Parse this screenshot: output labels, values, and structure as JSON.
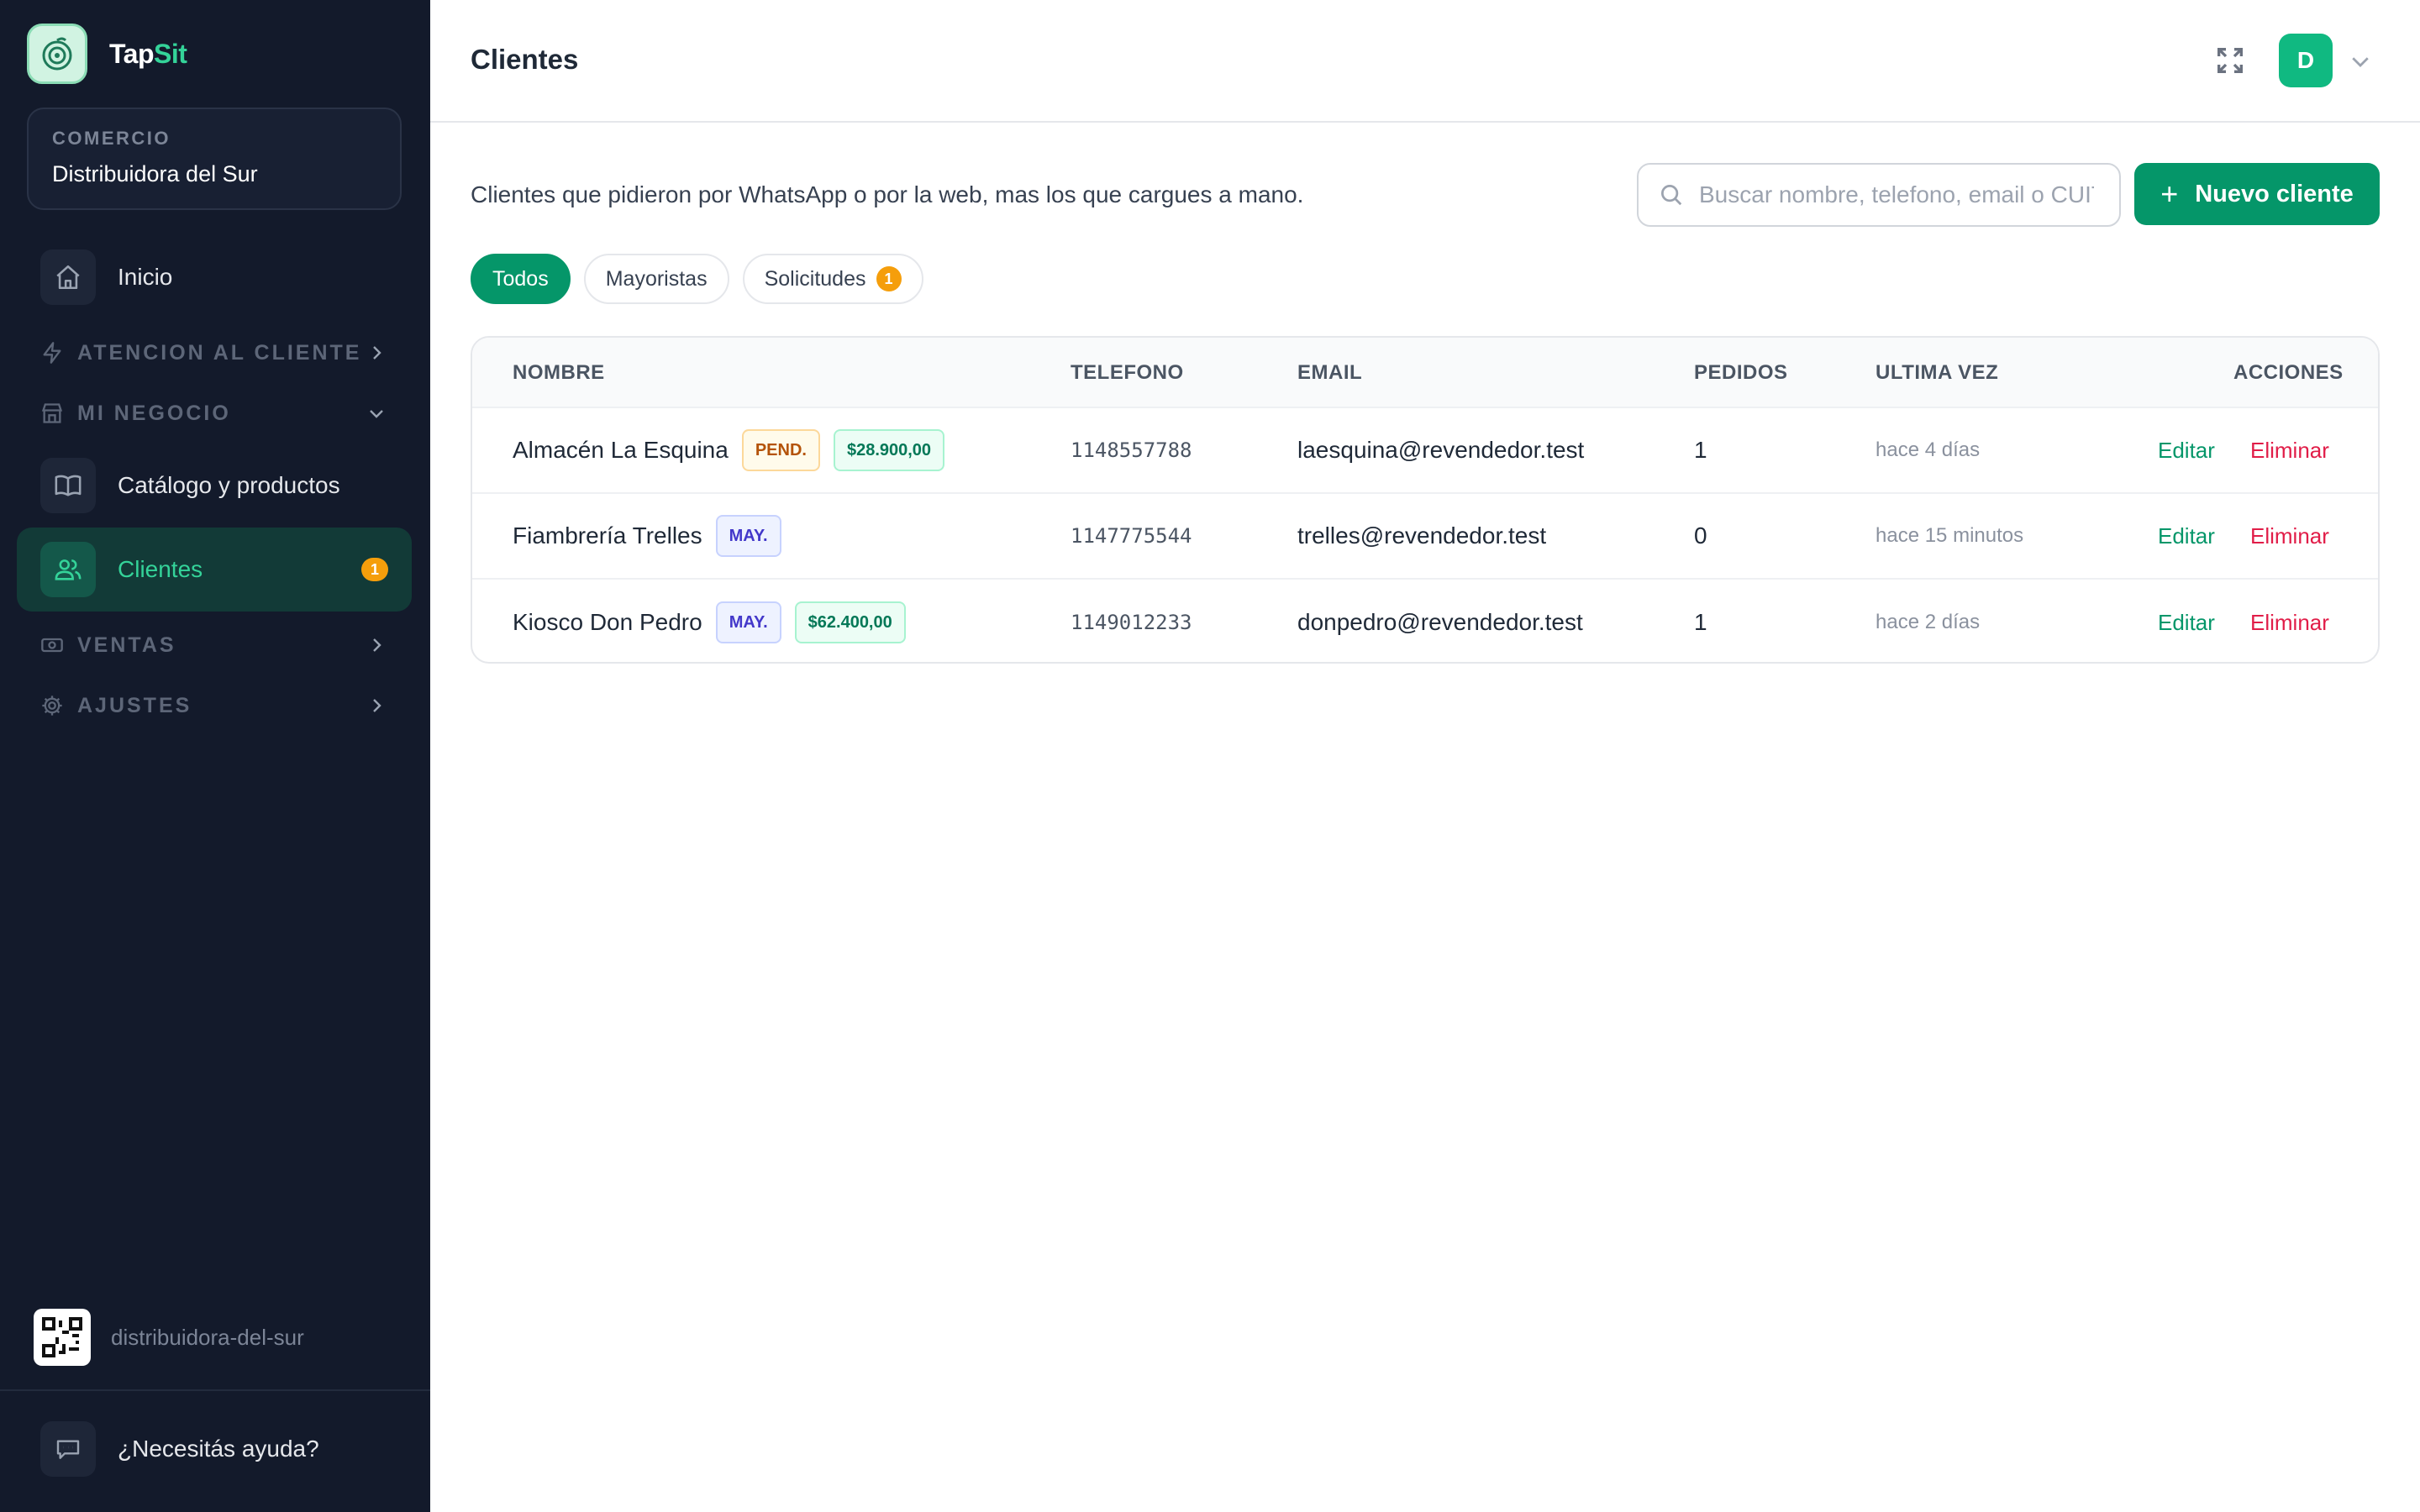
{
  "brand": {
    "name_part1": "Tap",
    "name_part2": "Sit",
    "accent_color": "#34d399"
  },
  "store": {
    "label": "COMERCIO",
    "name": "Distribuidora del Sur"
  },
  "sidebar": {
    "home": {
      "label": "Inicio",
      "icon": "home-icon"
    },
    "sections": [
      {
        "label": "ATENCION AL CLIENTE",
        "icon": "bolt-icon",
        "expanded": false
      },
      {
        "label": "MI NEGOCIO",
        "icon": "store-icon",
        "expanded": true
      },
      {
        "label": "VENTAS",
        "icon": "cash-icon",
        "expanded": false
      },
      {
        "label": "AJUSTES",
        "icon": "gear-icon",
        "expanded": false
      }
    ],
    "catalog": {
      "label": "Catálogo y productos",
      "icon": "book-icon"
    },
    "clients": {
      "label": "Clientes",
      "icon": "users-icon",
      "badge": "1",
      "active": true
    },
    "slug": "distribuidora-del-sur",
    "help": {
      "label": "¿Necesitás ayuda?",
      "icon": "chat-icon"
    }
  },
  "header": {
    "title": "Clientes",
    "avatar_initial": "D"
  },
  "content": {
    "subtitle": "Clientes que pidieron por WhatsApp o por la web, mas los que cargues a mano.",
    "search_placeholder": "Buscar nombre, telefono, email o CUIT",
    "new_button": "Nuevo cliente"
  },
  "filters": [
    {
      "label": "Todos",
      "active": true
    },
    {
      "label": "Mayoristas",
      "active": false
    },
    {
      "label": "Solicitudes",
      "active": false,
      "badge": "1"
    }
  ],
  "table": {
    "columns": [
      "NOMBRE",
      "TELEFONO",
      "EMAIL",
      "PEDIDOS",
      "ULTIMA VEZ",
      "ACCIONES"
    ],
    "rows": [
      {
        "name": "Almacén La Esquina",
        "tag": "PEND.",
        "amount": "$28.900,00",
        "phone": "1148557788",
        "email": "laesquina@revendedor.test",
        "orders": "1",
        "last_seen": "hace 4 días",
        "edit": "Editar",
        "delete": "Eliminar"
      },
      {
        "name": "Fiambrería Trelles",
        "tag": "MAY.",
        "amount": "",
        "phone": "1147775544",
        "email": "trelles@revendedor.test",
        "orders": "0",
        "last_seen": "hace 15 minutos",
        "edit": "Editar",
        "delete": "Eliminar"
      },
      {
        "name": "Kiosco Don Pedro",
        "tag": "MAY.",
        "amount": "$62.400,00",
        "phone": "1149012233",
        "email": "donpedro@revendedor.test",
        "orders": "1",
        "last_seen": "hace 2 días",
        "edit": "Editar",
        "delete": "Eliminar"
      }
    ]
  },
  "colors": {
    "primary": "#059669",
    "sidebar_bg": "#131a2b",
    "warning": "#f59e0b",
    "danger": "#e11d48"
  }
}
